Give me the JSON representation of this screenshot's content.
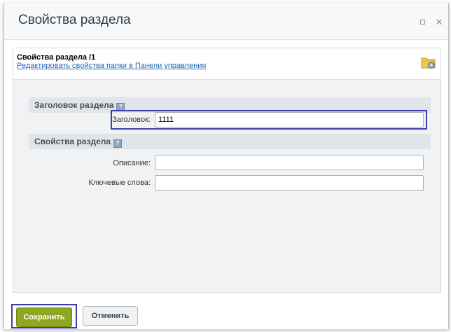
{
  "dialog": {
    "title": "Свойства раздела",
    "maximize_icon": "maximize-icon",
    "close_icon": "close-icon"
  },
  "info": {
    "title": "Свойства раздела /1",
    "link": "Редактировать свойства папки в Панели управления",
    "icon": "folder-settings-icon"
  },
  "sections": {
    "heading": {
      "title": "Заголовок раздела",
      "title_label": "Заголовок:",
      "title_value": "1111"
    },
    "properties": {
      "title": "Свойства раздела",
      "description_label": "Описание:",
      "description_value": "",
      "keywords_label": "Ключевые слова:",
      "keywords_value": ""
    },
    "help_icon": "help-icon"
  },
  "footer": {
    "save_label": "Сохранить",
    "cancel_label": "Отменить"
  },
  "colors": {
    "save_button": "#8fa61f",
    "highlight_border": "#3b3fad",
    "link": "#2067b0"
  }
}
